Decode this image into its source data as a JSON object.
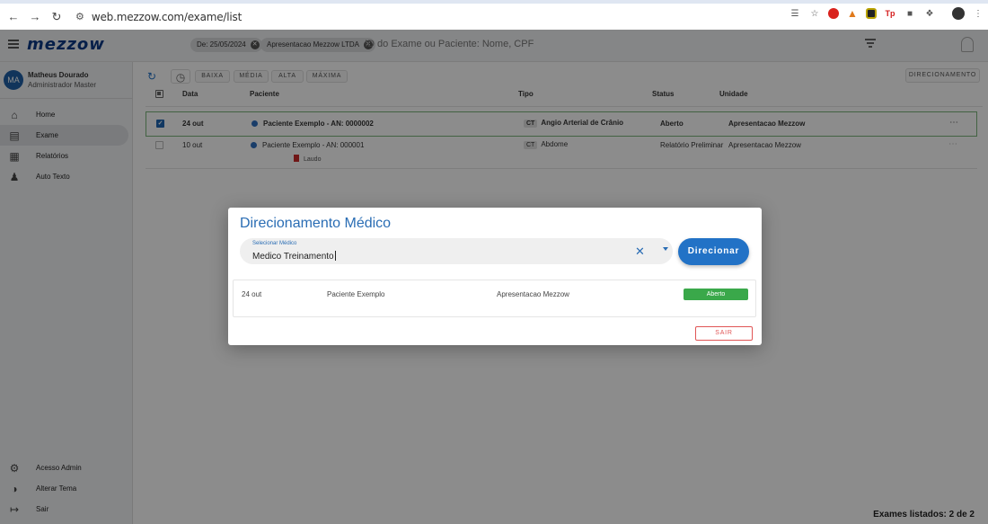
{
  "browser": {
    "url": "web.mezzow.com/exame/list"
  },
  "header": {
    "logo": "mezzow",
    "chips": [
      "De: 25/05/2024",
      "Apresentacao Mezzow LTDA"
    ],
    "search_placeholder": "ID do Exame ou Paciente: Nome, CPF"
  },
  "user": {
    "initials": "MA",
    "name": "Matheus Dourado",
    "role": "Administrador Master"
  },
  "sidebar": {
    "items": [
      {
        "label": "Home",
        "icon": "home-icon"
      },
      {
        "label": "Exame",
        "icon": "list-icon",
        "active": true
      },
      {
        "label": "Relatórios",
        "icon": "report-icon"
      },
      {
        "label": "Auto Texto",
        "icon": "people-icon"
      }
    ],
    "bottom_items": [
      {
        "label": "Acesso Admin",
        "icon": "gear-icon"
      },
      {
        "label": "Alterar Tema",
        "icon": "theme-icon"
      },
      {
        "label": "Sair",
        "icon": "logout-icon"
      }
    ]
  },
  "toolbar": {
    "buttons": [
      "BAIXA",
      "MÉDIA",
      "ALTA",
      "MÁXIMA"
    ],
    "direcionamento": "DIRECIONAMENTO"
  },
  "table": {
    "headers": [
      "Data",
      "Paciente",
      "Tipo",
      "Status",
      "Unidade"
    ],
    "rows": [
      {
        "date": "24 out",
        "patient": "Paciente Exemplo - AN: 0000002",
        "modality": "CT",
        "type": "Angio Arterial de Crânio",
        "status": "Aberto",
        "unit": "Apresentacao Mezzow",
        "selected": true
      },
      {
        "date": "10 out",
        "patient": "Paciente Exemplo - AN: 000001",
        "modality": "CT",
        "type": "Abdome",
        "status": "Relatório Preliminar",
        "unit": "Apresentacao Mezzow",
        "laudo": "Laudo"
      }
    ]
  },
  "footer": {
    "count": "Exames listados: 2 de 2"
  },
  "modal": {
    "title": "Direcionamento Médico",
    "select_label": "Selecionar Médico",
    "select_value": "Medico Treinamento",
    "direcionar": "Direcionar",
    "result": {
      "date": "24 out",
      "patient": "Paciente Exemplo",
      "unit": "Apresentacao Mezzow",
      "status": "Aberto"
    },
    "sair": "SAIR"
  },
  "colors": {
    "brand": "#0b3a86",
    "accent": "#2272c6",
    "status_open": "#3aa84a",
    "danger": "#e05555"
  }
}
